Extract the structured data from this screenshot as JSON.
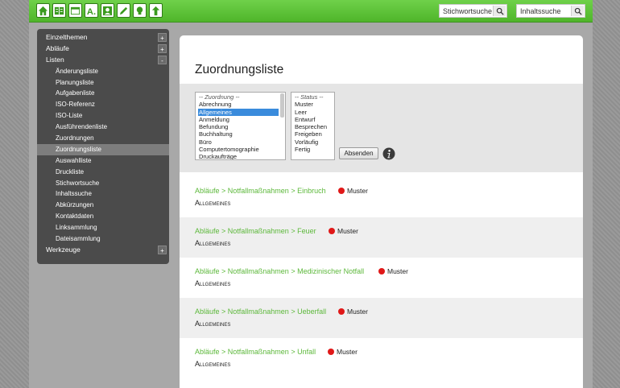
{
  "topbar": {
    "icons": [
      "home-icon",
      "book-icon",
      "window-icon",
      "font-icon",
      "user-icon",
      "pencil-icon",
      "bulb-icon",
      "upload-icon"
    ],
    "search1_label": "Stichwortsuche",
    "search2_label": "Inhaltssuche",
    "accent": "#4fb52a"
  },
  "sidebar": {
    "items": [
      {
        "label": "Einzelthemen",
        "toggle": "+"
      },
      {
        "label": "Abläufe",
        "toggle": "+"
      },
      {
        "label": "Listen",
        "toggle": "-"
      },
      {
        "label": "Änderungsliste"
      },
      {
        "label": "Planungsliste"
      },
      {
        "label": "Aufgabenliste"
      },
      {
        "label": "ISO-Referenz"
      },
      {
        "label": "ISO-Liste"
      },
      {
        "label": "Ausführendenliste"
      },
      {
        "label": "Zuordnungen"
      },
      {
        "label": "Zuordnungsliste"
      },
      {
        "label": "Auswahlliste"
      },
      {
        "label": "Druckliste"
      },
      {
        "label": "Stichwortsuche"
      },
      {
        "label": "Inhaltssuche"
      },
      {
        "label": "Abkürzungen"
      },
      {
        "label": "Kontaktdaten"
      },
      {
        "label": "Linksammlung"
      },
      {
        "label": "Dateisammlung"
      },
      {
        "label": "Werkzeuge",
        "toggle": "+"
      }
    ]
  },
  "main": {
    "title": "Zuordnungsliste",
    "zuordnung": {
      "header": "-- Zuordnung --",
      "options": [
        "Abrechnung",
        "Allgemeines",
        "Anmeldung",
        "Befundung",
        "Buchhaltung",
        "Büro",
        "Computertomographie",
        "Druckaufträge"
      ],
      "selected": "Allgemeines"
    },
    "status": {
      "header": "-- Status --",
      "options": [
        "Muster",
        "Leer",
        "Entwurf",
        "Besprechen",
        "Freigeben",
        "Vorläufig",
        "Fertig"
      ]
    },
    "submit_label": "Absenden",
    "results": [
      {
        "link": "Abläufe > Notfallmaßnahmen > Einbruch",
        "status": "Muster",
        "category": "Allgemeines"
      },
      {
        "link": "Abläufe > Notfallmaßnahmen > Feuer",
        "status": "Muster",
        "category": "Allgemeines"
      },
      {
        "link": "Abläufe > Notfallmaßnahmen > Medizinischer Notfall",
        "status": "Muster",
        "category": "Allgemeines"
      },
      {
        "link": "Abläufe > Notfallmaßnahmen > Ueberfall",
        "status": "Muster",
        "category": "Allgemeines"
      },
      {
        "link": "Abläufe > Notfallmaßnahmen > Unfall",
        "status": "Muster",
        "category": "Allgemeines"
      }
    ]
  }
}
